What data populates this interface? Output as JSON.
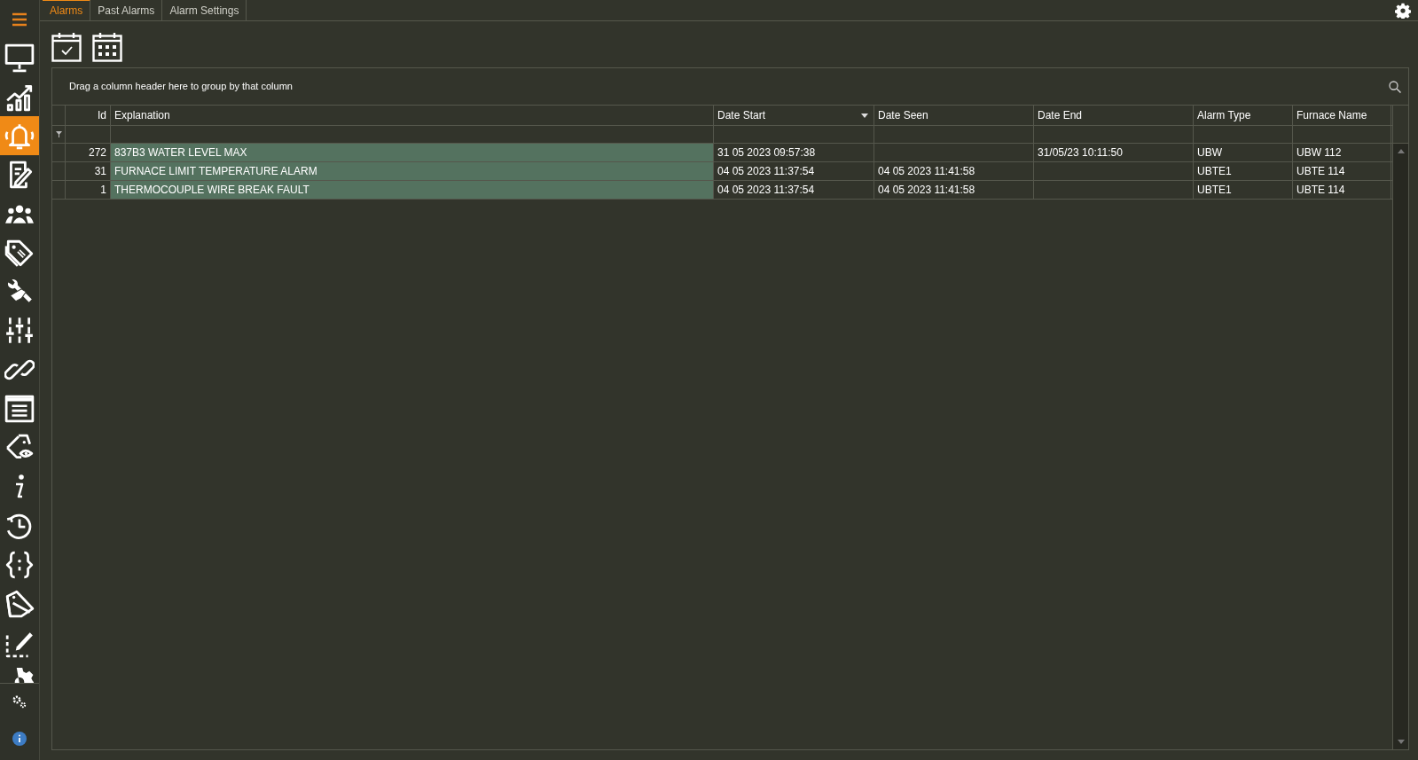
{
  "nav_items": [
    {
      "selected": false
    },
    {
      "selected": false
    },
    {
      "selected": true
    },
    {
      "selected": false
    },
    {
      "selected": false
    },
    {
      "selected": false
    },
    {
      "selected": false
    },
    {
      "selected": false
    },
    {
      "selected": false
    },
    {
      "selected": false
    },
    {
      "selected": false
    },
    {
      "selected": false
    },
    {
      "selected": false
    },
    {
      "selected": false
    },
    {
      "selected": false
    },
    {
      "selected": false
    },
    {
      "selected": false
    }
  ],
  "tabs": [
    {
      "label": "Alarms",
      "selected": true
    },
    {
      "label": "Past Alarms",
      "selected": false
    },
    {
      "label": "Alarm Settings",
      "selected": false
    }
  ],
  "grid": {
    "group_panel_hint": "Drag a column header here to group by that column",
    "columns": [
      {
        "label": "Id",
        "numeric": true,
        "sorted": false
      },
      {
        "label": "Explanation",
        "numeric": false,
        "sorted": false
      },
      {
        "label": "Date Start",
        "numeric": false,
        "sorted": true
      },
      {
        "label": "Date Seen",
        "numeric": false,
        "sorted": false
      },
      {
        "label": "Date End",
        "numeric": false,
        "sorted": false
      },
      {
        "label": "Alarm Type",
        "numeric": false,
        "sorted": false
      },
      {
        "label": "Furnace Name",
        "numeric": false,
        "sorted": false
      }
    ],
    "rows": [
      {
        "active": true,
        "cells": [
          "272",
          "837B3 WATER LEVEL MAX",
          "31 05 2023 09:57:38",
          "",
          "31/05/23 10:11:50",
          "UBW",
          "UBW 112"
        ]
      },
      {
        "active": true,
        "cells": [
          "31",
          "FURNACE LIMIT TEMPERATURE ALARM",
          "04 05 2023 11:37:54",
          "04 05 2023 11:41:58",
          "",
          "UBTE1",
          "UBTE 114"
        ]
      },
      {
        "active": true,
        "cells": [
          "1",
          "THERMOCOUPLE WIRE BREAK FAULT",
          "04 05 2023 11:37:54",
          "04 05 2023 11:41:58",
          "",
          "UBTE1",
          "UBTE 114"
        ]
      }
    ]
  }
}
